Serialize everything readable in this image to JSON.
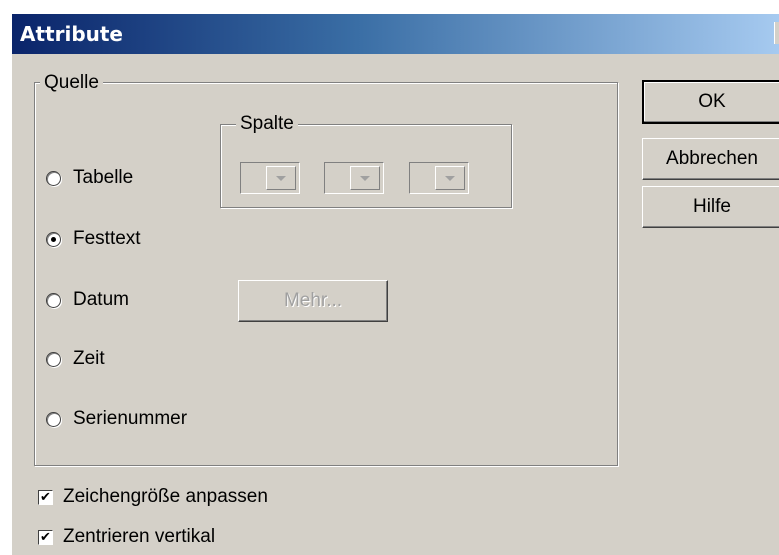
{
  "window": {
    "title": "Attribute"
  },
  "quelle": {
    "label": "Quelle",
    "radios": [
      {
        "label": "Tabelle",
        "checked": false
      },
      {
        "label": "Festtext",
        "checked": true
      },
      {
        "label": "Datum",
        "checked": false
      },
      {
        "label": "Zeit",
        "checked": false
      },
      {
        "label": "Serienummer",
        "checked": false
      }
    ],
    "spalte": {
      "label": "Spalte",
      "dropdowns": [
        "",
        "",
        ""
      ]
    },
    "more_button": "Mehr..."
  },
  "buttons": {
    "ok": "OK",
    "cancel": "Abbrechen",
    "help": "Hilfe"
  },
  "options": [
    {
      "label": "Zeichengröße anpassen",
      "checked": true
    },
    {
      "label": "Zentrieren vertikal",
      "checked": true
    }
  ],
  "icons": {
    "checkmark": "✔"
  }
}
